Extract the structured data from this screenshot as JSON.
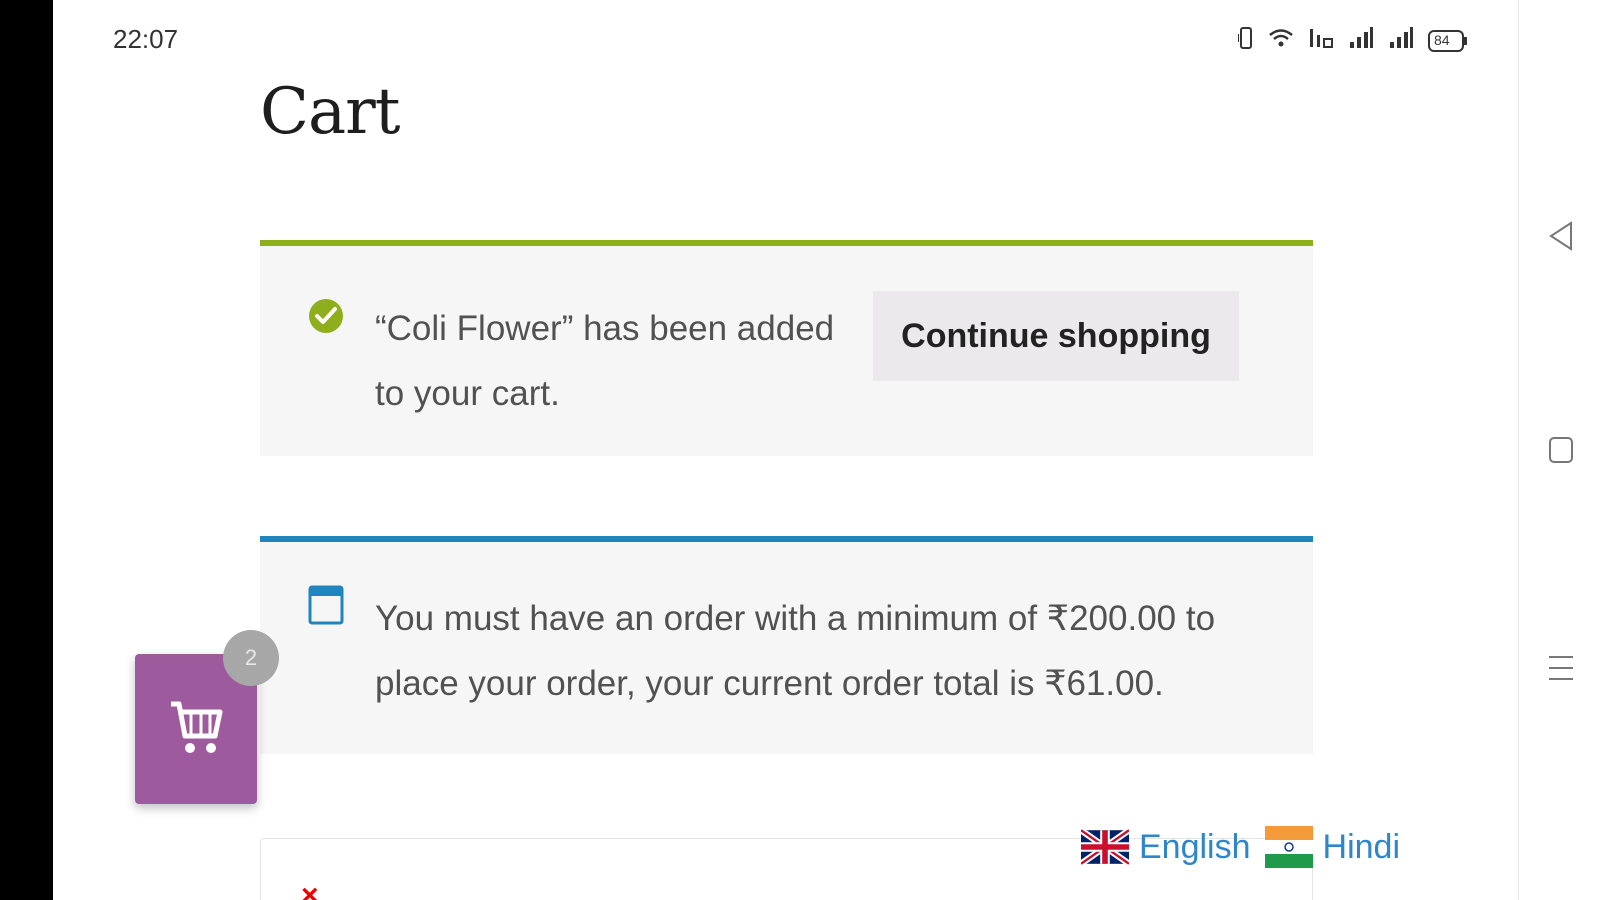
{
  "status_bar": {
    "time": "22:07",
    "battery": "84",
    "icons": [
      "vibrate-icon",
      "wifi-icon",
      "volte-icon",
      "signal-icon",
      "signal-icon",
      "battery-icon"
    ]
  },
  "page": {
    "title": "Cart"
  },
  "success_notice": {
    "message": "“Coli Flower” has been added to your cart.",
    "button_label": "Continue shopping",
    "accent": "#8fae1b",
    "icon": "check-circle-icon"
  },
  "info_notice": {
    "message": "You must have an order with a minimum of ₹200.00 to place your order, your current order total is ₹61.00.",
    "accent": "#1e85be",
    "icon": "calendar-icon"
  },
  "cart_widget": {
    "count": "2",
    "color": "#9d5b9d",
    "icon": "shopping-cart-icon"
  },
  "languages": [
    {
      "label": "English",
      "flag": "uk-flag-icon"
    },
    {
      "label": "Hindi",
      "flag": "india-flag-icon"
    }
  ],
  "cart_table": {
    "remove_symbol": "×"
  },
  "android_nav": [
    "back-icon",
    "home-icon",
    "menu-icon"
  ]
}
